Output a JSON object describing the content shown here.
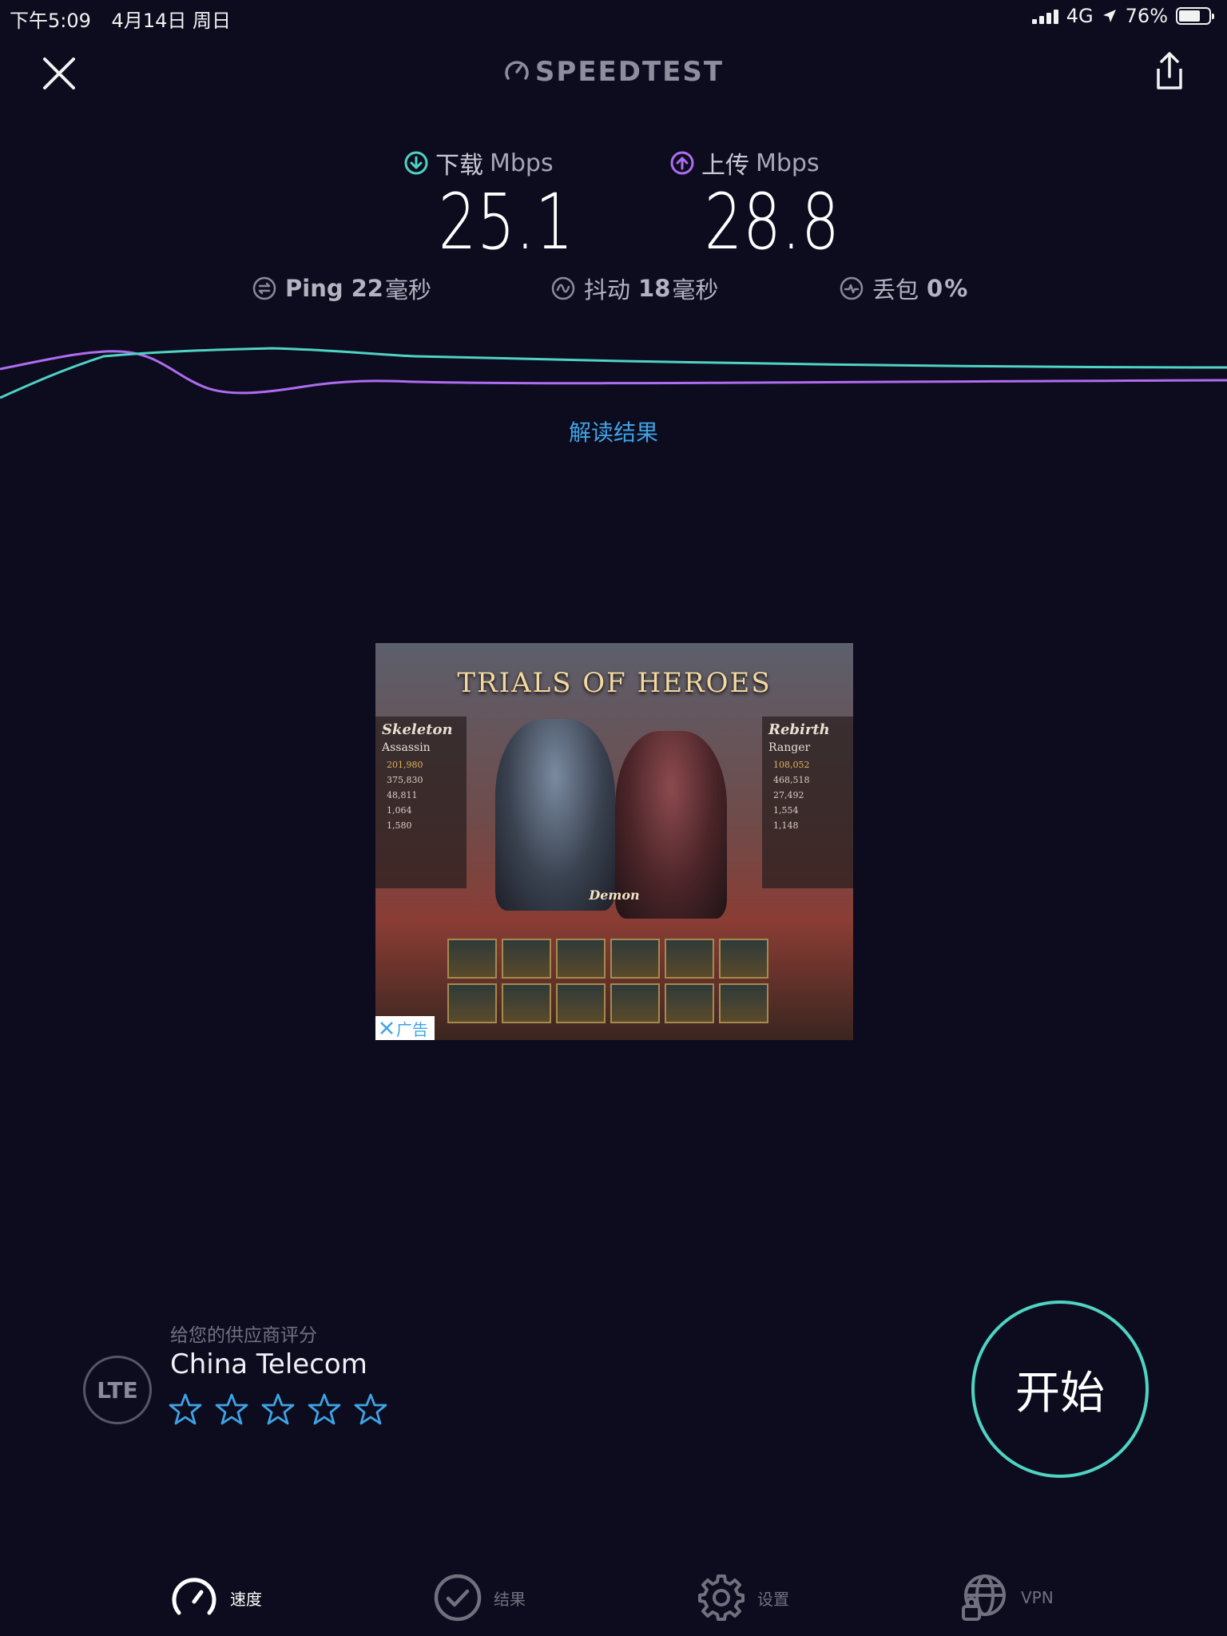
{
  "status_bar": {
    "time": "下午5:09",
    "date": "4月14日 周日",
    "network": "4G",
    "battery": "76%",
    "battery_level": 0.76
  },
  "header": {
    "brand": "SPEEDTEST",
    "close_icon": "close-icon",
    "share_icon": "share-icon"
  },
  "results": {
    "download": {
      "label": "下载",
      "unit": "Mbps",
      "value": "25.1",
      "color": "#4fd3c4"
    },
    "upload": {
      "label": "上传",
      "unit": "Mbps",
      "value": "28.8",
      "color": "#b06cf0"
    },
    "ping": {
      "label": "Ping",
      "value": "22",
      "unit": "毫秒"
    },
    "jitter": {
      "label": "抖动",
      "value": "18",
      "unit": "毫秒"
    },
    "loss": {
      "label": "丢包",
      "value": "0",
      "unit": "%"
    }
  },
  "interpret_link": "解读结果",
  "ad": {
    "title": "TRIALS OF HEROES",
    "left_panel": {
      "name": "Skeleton",
      "role": "Assassin",
      "stats": [
        "201,980",
        "375,830",
        "48,811",
        "1,064",
        "1,580"
      ]
    },
    "right_panel": {
      "name": "Rebirth",
      "role": "Ranger",
      "stats": [
        "108,052",
        "468,518",
        "27,492",
        "1,554",
        "1,148"
      ]
    },
    "demon": "Demon",
    "badge": "广告"
  },
  "provider": {
    "rate_label": "给您的供应商评分",
    "name": "China Telecom",
    "tech": "LTE",
    "star_count": 5,
    "rating": 0,
    "star_color": "#3fa3e6"
  },
  "start_button": "开始",
  "accent_colors": {
    "download": "#4fd3c4",
    "upload": "#b06cf0",
    "link": "#3fa3e6",
    "background": "#0c0c1e"
  },
  "tabs": [
    {
      "label": "速度",
      "icon": "speedometer-icon",
      "active": true
    },
    {
      "label": "结果",
      "icon": "checkmark-circle-icon",
      "active": false
    },
    {
      "label": "设置",
      "icon": "gear-icon",
      "active": false
    },
    {
      "label": "VPN",
      "icon": "vpn-globe-lock-icon",
      "active": false
    }
  ]
}
